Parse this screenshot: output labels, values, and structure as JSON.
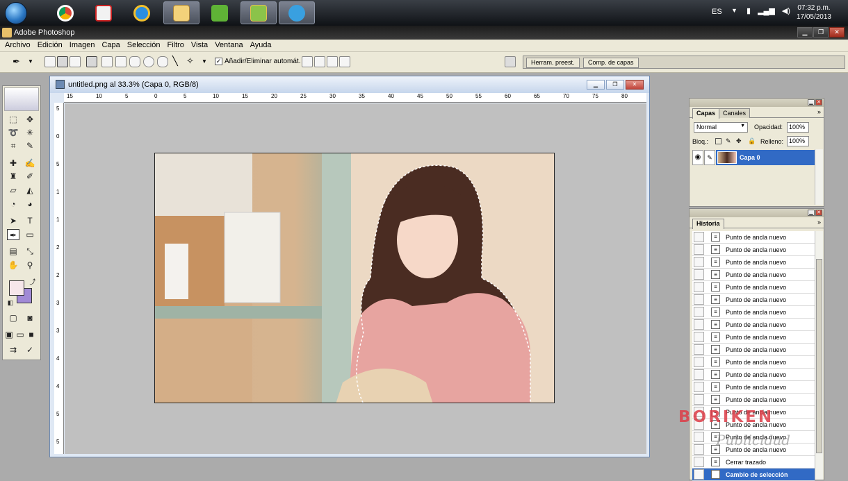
{
  "taskbar": {
    "language": "ES",
    "time": "07:32 p.m.",
    "date": "17/05/2013",
    "apps": [
      "chrome",
      "video-321",
      "internet-explorer",
      "file-explorer",
      "camtasia",
      "photoshop",
      "messenger"
    ]
  },
  "app": {
    "title": "Adobe Photoshop"
  },
  "menu": [
    "Archivo",
    "Edición",
    "Imagen",
    "Capa",
    "Selección",
    "Filtro",
    "Vista",
    "Ventana",
    "Ayuda"
  ],
  "options": {
    "auto_add_label": "Añadir/Eliminar automát.",
    "auto_add_checked": "✓",
    "well_tabs": [
      "Herram. preest.",
      "Comp. de capas"
    ]
  },
  "document": {
    "title": "untitled.png al 33.3% (Capa 0, RGB/8)",
    "ruler_h": [
      "15",
      "10",
      "5",
      "0",
      "5",
      "10",
      "15",
      "20",
      "25",
      "30",
      "35",
      "40",
      "45",
      "50",
      "55",
      "60",
      "65",
      "70",
      "75",
      "80"
    ],
    "ruler_v": [
      "5",
      "0",
      "5",
      "1",
      "1",
      "2",
      "2",
      "3",
      "3",
      "4",
      "4",
      "5",
      "5"
    ]
  },
  "layers": {
    "tabs": [
      "Capas",
      "Canales"
    ],
    "blend_mode": "Normal",
    "opacity_label": "Opacidad:",
    "opacity": "100%",
    "lock_label": "Bloq.:",
    "fill_label": "Relleno:",
    "fill": "100%",
    "layer_name": "Capa 0"
  },
  "history": {
    "tab": "Historia",
    "items": [
      "Punto de ancla nuevo",
      "Punto de ancla nuevo",
      "Punto de ancla nuevo",
      "Punto de ancla nuevo",
      "Punto de ancla nuevo",
      "Punto de ancla nuevo",
      "Punto de ancla nuevo",
      "Punto de ancla nuevo",
      "Punto de ancla nuevo",
      "Punto de ancla nuevo",
      "Punto de ancla nuevo",
      "Punto de ancla nuevo",
      "Punto de ancla nuevo",
      "Punto de ancla nuevo",
      "Punto de ancla nuevo",
      "Punto de ancla nuevo",
      "Punto de ancla nuevo",
      "Punto de ancla nuevo",
      "Cerrar trazado",
      "Cambio de selección"
    ],
    "current": "Cambio de selección"
  },
  "watermark": {
    "logo": "BORIKEN",
    "sub": "Publicidad"
  },
  "colors": {
    "foreground": "#f6e6ea",
    "background": "#a18ad6",
    "selection": "#316ac5"
  }
}
